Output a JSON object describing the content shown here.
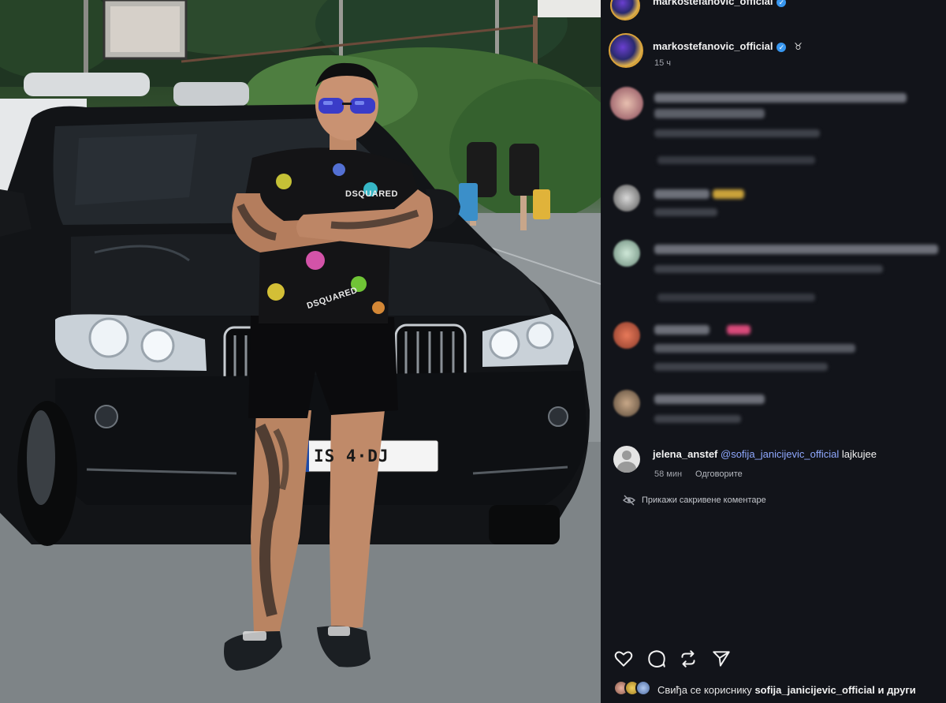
{
  "post": {
    "author": "markostefanovic_official",
    "author_top": "markostefanovic_official",
    "time": "15 ч",
    "verified_mark": "✓"
  },
  "photo": {
    "plate": "IS 4·DJ",
    "shirt_brand_1": "DSQUARED",
    "shirt_brand_2": "DSQUARED"
  },
  "comments": [
    {
      "blurred": true
    },
    {
      "blurred": true
    },
    {
      "blurred": true
    },
    {
      "blurred": true
    },
    {
      "blurred": true
    },
    {
      "user": "jelena_anstef",
      "mention": "@sofija_janicijevic_official",
      "text": "lajkujee",
      "time": "58 мин",
      "reply_label": "Одговорите"
    }
  ],
  "hidden_comments_label": "Прикажи сакривене коментаре",
  "actions": {
    "like_icon": "heart-icon",
    "comment_icon": "comment-icon",
    "share_icon": "repost-icon",
    "send_icon": "send-icon"
  },
  "likes": {
    "prefix": "Свиђа се кориснику",
    "user": "sofija_janicijevic_official",
    "suffix": "и други"
  },
  "colors": {
    "panel_bg": "#12141a",
    "accent_blue": "#3897f0",
    "mention_blue": "#8fa8ff"
  }
}
